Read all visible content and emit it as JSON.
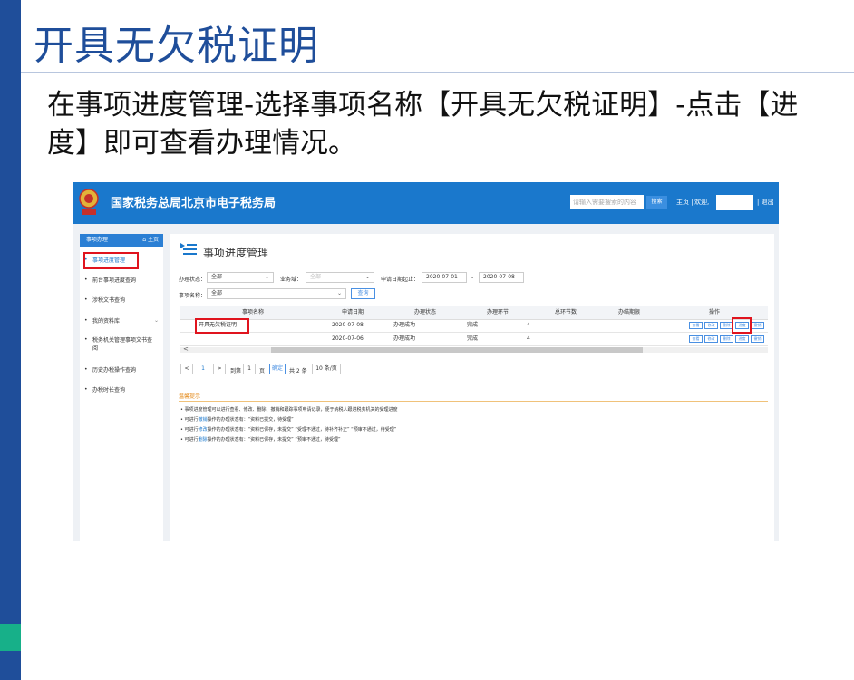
{
  "slide": {
    "title": "开具无欠税证明",
    "body": "在事项进度管理-选择事项名称【开具无欠税证明】-点击【进度】即可查看办理情况。"
  },
  "colors": {
    "slide_accent": "#1f4e9a",
    "bar_green": "#17b089",
    "app_header": "#1a78cc",
    "highlight_red": "#e0141e"
  },
  "app": {
    "title": "国家税务总局北京市电子税务局",
    "search_placeholder": "请输入需要搜索的内容",
    "search_button": "搜索",
    "nav_home": "主页 |",
    "nav_welcome": "欢迎,",
    "nav_logout": "| 退出"
  },
  "sidebar": {
    "header": "事项办理",
    "home": "⌂ 主页",
    "items": [
      {
        "label": "事项进度管理",
        "icon": "dot-icon"
      },
      {
        "label": "前台事项进度查询",
        "icon": "dot-icon"
      },
      {
        "label": "涉税文书查询",
        "icon": "dot-icon"
      },
      {
        "label": "我的资料库",
        "icon": "dot-icon"
      },
      {
        "label": "税务机关管理事项文书查 阅",
        "icon": "dot-icon"
      },
      {
        "label": "历史办税操作查询",
        "icon": "dot-icon"
      },
      {
        "label": "办税时长查询",
        "icon": "dot-icon"
      }
    ]
  },
  "content": {
    "heading": "事项进度管理",
    "filters": {
      "status_label": "办理状态：",
      "status_value": "全部",
      "domain_label": "业务域：",
      "domain_value": "全部",
      "date_label": "申请日期起止：",
      "date_from": "2020-07-01",
      "date_sep": "-",
      "date_to": "2020-07-08",
      "name_label": "事项名称：",
      "name_value": "全部",
      "query_button": "查询"
    },
    "table": {
      "headers": [
        "事项名称",
        "申请日期",
        "办理状态",
        "办理环节",
        "总环节数",
        "办结期限",
        "操作"
      ],
      "rows": [
        {
          "name": "开具无欠税证明",
          "date": "2020-07-08",
          "status": "办理成功",
          "stage": "完成",
          "total": "4",
          "deadline": ""
        },
        {
          "name": "",
          "date": "2020-07-06",
          "status": "办理成功",
          "stage": "完成",
          "total": "4",
          "deadline": ""
        }
      ],
      "actions": [
        "查看",
        "修改",
        "删除",
        "进度",
        "撤销"
      ]
    },
    "pager": {
      "prev": "<",
      "page": "1",
      "next": ">",
      "goto_label": "到第",
      "goto_value": "1",
      "page_unit": "页",
      "confirm": "确定",
      "total": "共 2 条",
      "page_size": "10 条/页"
    },
    "tips": {
      "title": "温馨提示",
      "lines": [
        {
          "pre": "事项进度管理可以进行查看、修改、删除、撤销和跟踪事项申请记录，便于纳税人跟进税务机关的受理进度",
          "hl": "",
          "post": ""
        },
        {
          "pre": "可进行",
          "hl": "撤销",
          "post": "操作的办理状态有：“资料已提交，待受理”"
        },
        {
          "pre": "可进行",
          "hl": "修改",
          "post": "操作的办理状态有：“资料已保存，未提交” “受理不通过，待补齐补正” “预审不通过，待受理”"
        },
        {
          "pre": "可进行",
          "hl": "删除",
          "post": "操作的办理状态有：“资料已保存，未提交” “预审不通过，待受理”"
        }
      ]
    }
  }
}
